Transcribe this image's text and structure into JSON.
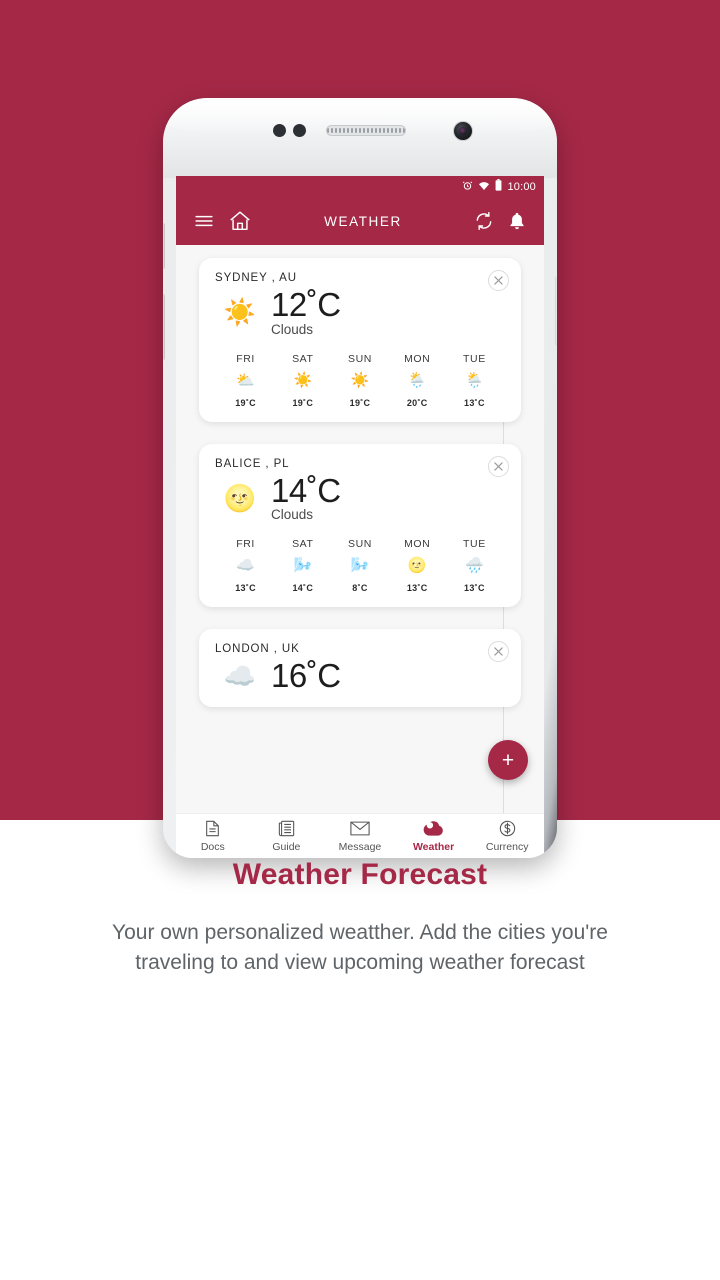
{
  "theme": {
    "brand": "#A52847",
    "screen_bg": "#f7f7f7",
    "card_bg": "#ffffff"
  },
  "phone": {
    "status_bar": {
      "alarm_icon": "alarm-icon",
      "wifi_icon": "wifi-icon",
      "battery_icon": "battery-icon",
      "clock": "10:00"
    },
    "app_bar": {
      "menu_icon": "hamburger-menu-icon",
      "home_icon": "home-icon",
      "title": "WEATHER",
      "refresh_icon": "refresh-icon",
      "bell_icon": "notification-bell-icon"
    },
    "fab": {
      "label": "+",
      "name": "add-city-button"
    },
    "bottom_nav": [
      {
        "label": "Docs",
        "icon": "document-icon",
        "active": false
      },
      {
        "label": "Guide",
        "icon": "newspaper-icon",
        "active": false
      },
      {
        "label": "Message",
        "icon": "envelope-icon",
        "active": false
      },
      {
        "label": "Weather",
        "icon": "cloud-icon",
        "active": true
      },
      {
        "label": "Currency",
        "icon": "dollar-circle-icon",
        "active": false
      }
    ]
  },
  "cards": [
    {
      "city": "SYDNEY , AU",
      "now_icon": "sun-icon",
      "now_temp": "12˚C",
      "now_desc": "Clouds",
      "close_icon": "close-icon",
      "forecast": [
        {
          "day": "FRI",
          "icon": "sun-behind-cloud-icon",
          "temp": "19˚C"
        },
        {
          "day": "SAT",
          "icon": "sun-icon",
          "temp": "19˚C"
        },
        {
          "day": "SUN",
          "icon": "sun-icon",
          "temp": "19˚C"
        },
        {
          "day": "MON",
          "icon": "sun-behind-rain-icon",
          "temp": "20˚C"
        },
        {
          "day": "TUE",
          "icon": "sun-behind-rain-icon",
          "temp": "13˚C"
        }
      ]
    },
    {
      "city": "BALICE , PL",
      "now_icon": "sun-dim-icon",
      "now_temp": "14˚C",
      "now_desc": "Clouds",
      "close_icon": "close-icon",
      "forecast": [
        {
          "day": "FRI",
          "icon": "cloud-icon",
          "temp": "13˚C"
        },
        {
          "day": "SAT",
          "icon": "cloud-wind-icon",
          "temp": "14˚C"
        },
        {
          "day": "SUN",
          "icon": "cloud-wind-icon",
          "temp": "8˚C"
        },
        {
          "day": "MON",
          "icon": "sun-dim-icon",
          "temp": "13˚C"
        },
        {
          "day": "TUE",
          "icon": "cloud-behind-rain-icon",
          "temp": "13˚C"
        }
      ]
    },
    {
      "city": "LONDON , UK",
      "now_icon": "cloud-icon",
      "now_temp": "16˚C",
      "now_desc": "",
      "close_icon": "close-icon",
      "forecast": []
    }
  ],
  "caption": {
    "title": "Weather Forecast",
    "body": "Your own personalized weatther. Add the cities you're traveling to and view upcoming weather forecast"
  }
}
